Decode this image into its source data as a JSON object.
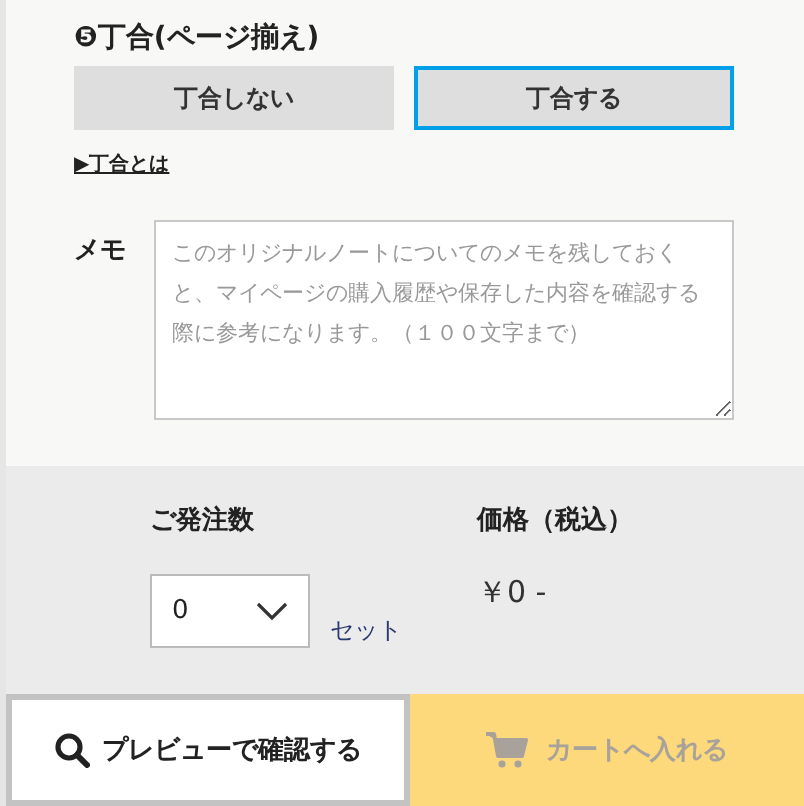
{
  "binding_section": {
    "title": "❺丁合(ページ揃え)",
    "options": [
      {
        "label": "丁合しない",
        "selected": false
      },
      {
        "label": "丁合する",
        "selected": true
      }
    ],
    "link": "▶丁合とは"
  },
  "memo": {
    "label": "メモ",
    "placeholder": "このオリジナルノートについてのメモを残しておくと、マイページの購入履歴や保存した内容を確認する際に参考になります。（１００文字まで）"
  },
  "order": {
    "quantity_label": "ご発注数",
    "quantity_value": "0",
    "unit": "セット",
    "price_label": "価格（税込）",
    "price": "￥0 -"
  },
  "actions": {
    "preview_button": "プレビューで確認する",
    "cart_button": {
      "label": "カートへ入れる",
      "disabled": true
    }
  }
}
